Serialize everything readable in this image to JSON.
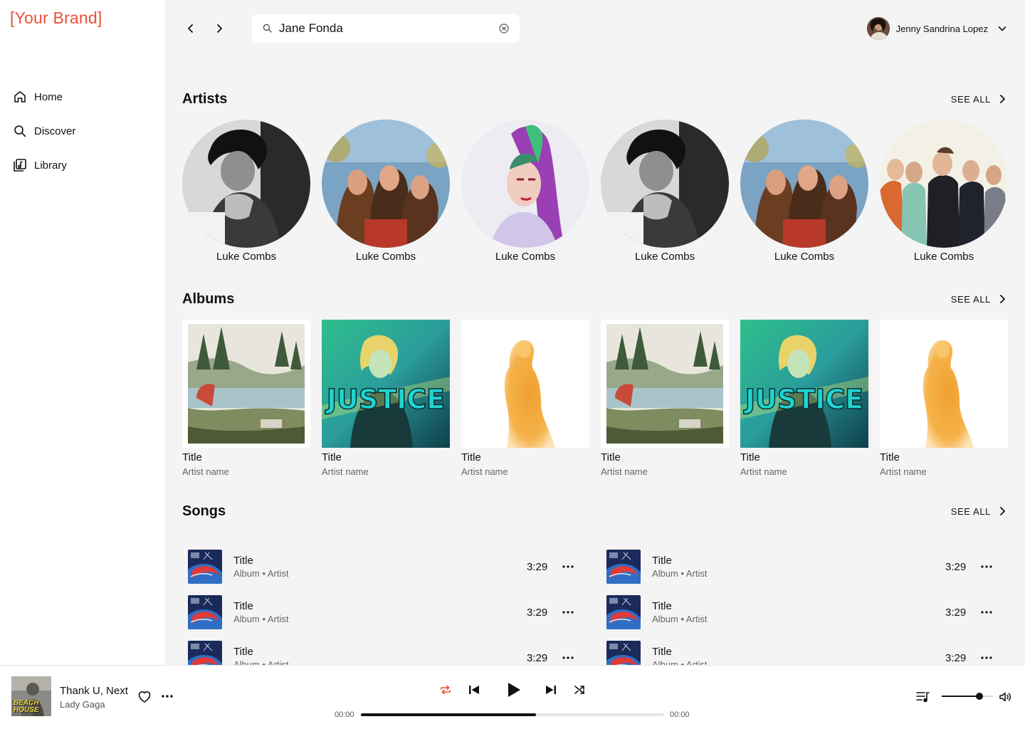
{
  "brand": "[Your Brand]",
  "colors": {
    "accent": "#ea4f37",
    "background": "#f4f4f4",
    "surface": "#ffffff",
    "text": "#111111",
    "muted": "#666666"
  },
  "sidebar": {
    "items": [
      {
        "label": "Home",
        "icon": "home-icon"
      },
      {
        "label": "Discover",
        "icon": "search-icon"
      },
      {
        "label": "Library",
        "icon": "library-icon"
      }
    ]
  },
  "header": {
    "search_value": "Jane Fonda",
    "user_name": "Jenny Sandrina Lopez"
  },
  "artists": {
    "title": "Artists",
    "see_all": "SEE ALL",
    "items": [
      {
        "name": "Luke Combs",
        "art": "bw"
      },
      {
        "name": "Luke Combs",
        "art": "band"
      },
      {
        "name": "Luke Combs",
        "art": "portrait"
      },
      {
        "name": "Luke Combs",
        "art": "bw"
      },
      {
        "name": "Luke Combs",
        "art": "band"
      },
      {
        "name": "Luke Combs",
        "art": "group"
      }
    ]
  },
  "albums": {
    "title": "Albums",
    "see_all": "SEE ALL",
    "items": [
      {
        "title": "Title",
        "artist": "Artist name",
        "art": "landscape"
      },
      {
        "title": "Title",
        "artist": "Artist name",
        "art": "justice"
      },
      {
        "title": "Title",
        "artist": "Artist name",
        "art": "orange"
      },
      {
        "title": "Title",
        "artist": "Artist name",
        "art": "landscape"
      },
      {
        "title": "Title",
        "artist": "Artist name",
        "art": "justice"
      },
      {
        "title": "Title",
        "artist": "Artist name",
        "art": "orange"
      }
    ]
  },
  "songs": {
    "title": "Songs",
    "see_all": "SEE ALL",
    "items": [
      {
        "title": "Title",
        "meta": "Album • Artist",
        "duration": "3:29"
      },
      {
        "title": "Title",
        "meta": "Album • Artist",
        "duration": "3:29"
      },
      {
        "title": "Title",
        "meta": "Album • Artist",
        "duration": "3:29"
      },
      {
        "title": "Title",
        "meta": "Album • Artist",
        "duration": "3:29"
      },
      {
        "title": "Title",
        "meta": "Album • Artist",
        "duration": "3:29"
      },
      {
        "title": "Title",
        "meta": "Album • Artist",
        "duration": "3:29"
      }
    ]
  },
  "player": {
    "track_title": "Thank U, Next",
    "track_artist": "Lady Gaga",
    "cover_text": "BEACH HOUSE",
    "elapsed": "00:00",
    "remaining": "00:00",
    "progress_percent": 57.7,
    "volume_percent": 73
  }
}
